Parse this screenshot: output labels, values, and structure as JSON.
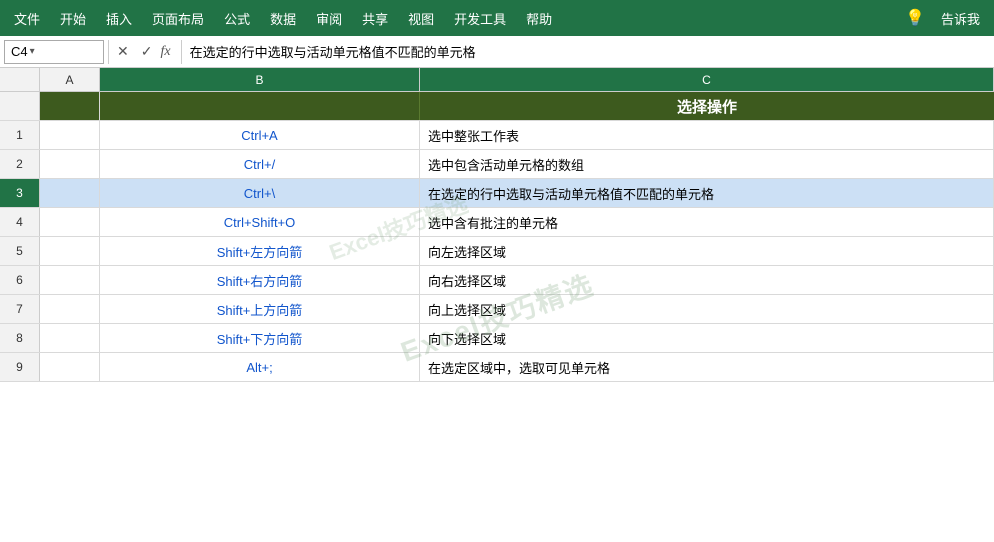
{
  "ribbon": {
    "items": [
      "文件",
      "开始",
      "插入",
      "页面布局",
      "公式",
      "数据",
      "审阅",
      "共享",
      "视图",
      "开发工具",
      "帮助"
    ],
    "right_items": [
      "告诉我"
    ],
    "lightbulb": "💡"
  },
  "formula_bar": {
    "name_box": "C4",
    "cancel_icon": "✕",
    "confirm_icon": "✓",
    "fx_label": "fx",
    "formula": "在选定的行中选取与活动单元格值不匹配的单元格"
  },
  "columns": {
    "a_label": "A",
    "b_label": "B",
    "c_label": "C"
  },
  "watermark": "Excel技巧精选",
  "table": {
    "header": "选择操作",
    "rows": [
      {
        "num": "1",
        "shortcut": "Ctrl+A",
        "description": "选中整张工作表"
      },
      {
        "num": "2",
        "shortcut": "Ctrl+/",
        "description": "选中包含活动单元格的数组"
      },
      {
        "num": "3",
        "shortcut": "Ctrl+\\",
        "description": "在选定的行中选取与活动单元格值不匹配的单元格"
      },
      {
        "num": "4",
        "shortcut": "Ctrl+Shift+O",
        "description": "选中含有批注的单元格"
      },
      {
        "num": "5",
        "shortcut": "Shift+左方向箭",
        "description": "向左选择区域"
      },
      {
        "num": "6",
        "shortcut": "Shift+右方向箭",
        "description": "向右选择区域"
      },
      {
        "num": "7",
        "shortcut": "Shift+上方向箭",
        "description": "向上选择区域"
      },
      {
        "num": "8",
        "shortcut": "Shift+下方向箭",
        "description": "向下选择区域"
      },
      {
        "num": "9",
        "shortcut": "Alt+;",
        "description": "在选定区域中，选取可见单元格"
      }
    ]
  }
}
